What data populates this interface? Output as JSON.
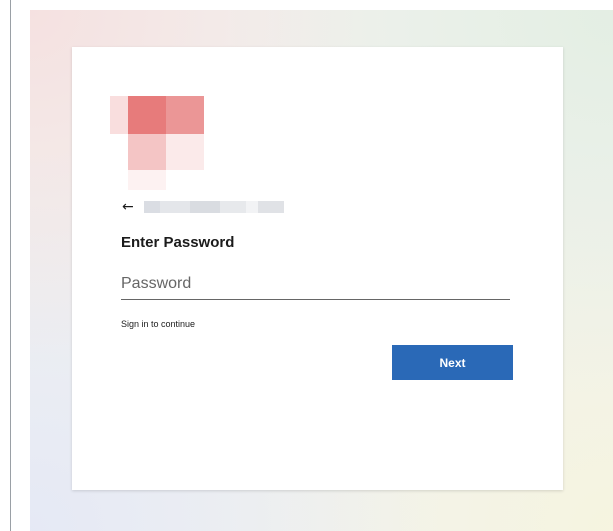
{
  "login": {
    "title": "Enter Password",
    "password_placeholder": "Password",
    "password_value": "",
    "hint": "Sign in to continue",
    "next_label": "Next",
    "back_icon": "←"
  },
  "colors": {
    "button": "#2a69b7",
    "logo_primary": "#e77b7b",
    "logo_secondary": "#eb9696"
  },
  "icons": {
    "back": "back-arrow-icon",
    "logo": "brand-logo-icon"
  }
}
